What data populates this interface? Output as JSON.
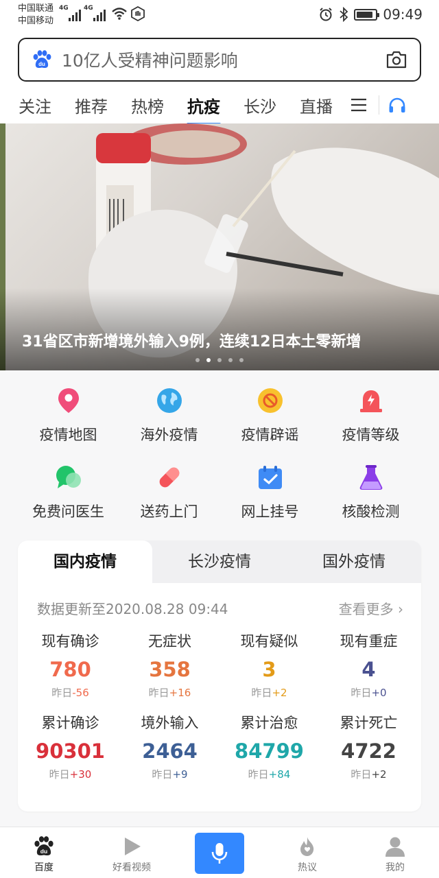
{
  "status_bar": {
    "carrier1": "中国联通",
    "carrier2": "中国移动",
    "net1": "4G",
    "net2": "4G",
    "time": "09:49"
  },
  "search": {
    "placeholder": "10亿人受精神问题影响"
  },
  "tabs": [
    "关注",
    "推荐",
    "热榜",
    "抗疫",
    "长沙",
    "直播"
  ],
  "banner": {
    "caption": "31省区市新增境外输入9例，连续12日本土零新增"
  },
  "shortcuts": [
    {
      "label": "疫情地图",
      "icon": "map-pin-icon"
    },
    {
      "label": "海外疫情",
      "icon": "globe-icon"
    },
    {
      "label": "疫情辟谣",
      "icon": "no-rumor-icon"
    },
    {
      "label": "疫情等级",
      "icon": "alert-siren-icon"
    },
    {
      "label": "免费问医生",
      "icon": "chat-bubble-icon"
    },
    {
      "label": "送药上门",
      "icon": "pill-icon"
    },
    {
      "label": "网上挂号",
      "icon": "calendar-check-icon"
    },
    {
      "label": "核酸检测",
      "icon": "flask-icon"
    }
  ],
  "epidemic_card": {
    "tabs": [
      "国内疫情",
      "长沙疫情",
      "国外疫情"
    ],
    "updated": "数据更新至2020.08.28 09:44",
    "more": "查看更多",
    "stats": [
      {
        "label": "现有确诊",
        "value": "780",
        "yesterday_label": "昨日",
        "delta": "-56",
        "color": "#f06a4d"
      },
      {
        "label": "无症状",
        "value": "358",
        "yesterday_label": "昨日",
        "delta": "+16",
        "color": "#e5753f"
      },
      {
        "label": "现有疑似",
        "value": "3",
        "yesterday_label": "昨日",
        "delta": "+2",
        "color": "#e39b18"
      },
      {
        "label": "现有重症",
        "value": "4",
        "yesterday_label": "昨日",
        "delta": "+0",
        "color": "#4a5190"
      },
      {
        "label": "累计确诊",
        "value": "90301",
        "yesterday_label": "昨日",
        "delta": "+30",
        "color": "#d9303a"
      },
      {
        "label": "境外输入",
        "value": "2464",
        "yesterday_label": "昨日",
        "delta": "+9",
        "color": "#3d5f95"
      },
      {
        "label": "累计治愈",
        "value": "84799",
        "yesterday_label": "昨日",
        "delta": "+84",
        "color": "#1fa7a9"
      },
      {
        "label": "累计死亡",
        "value": "4722",
        "yesterday_label": "昨日",
        "delta": "+2",
        "color": "#444444"
      }
    ]
  },
  "bottom_nav": [
    {
      "label": "百度",
      "icon": "baidu-paw-icon"
    },
    {
      "label": "好看视频",
      "icon": "play-icon"
    },
    {
      "label": "",
      "icon": "microphone-icon"
    },
    {
      "label": "热议",
      "icon": "flame-icon"
    },
    {
      "label": "我的",
      "icon": "user-icon"
    }
  ]
}
